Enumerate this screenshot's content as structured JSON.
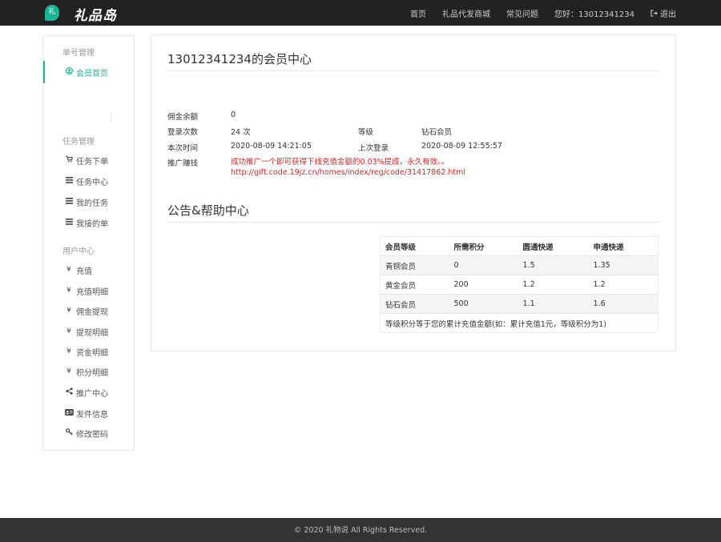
{
  "header": {
    "logo_badge": "礼",
    "logo_text": "礼品岛",
    "nav": [
      "首页",
      "礼品代发商城",
      "常见问题"
    ],
    "greeting": "您好：13012341234",
    "logout": "退出"
  },
  "sidebar": {
    "section1": "单号管理",
    "member_home": "会员首页",
    "section2": "任务管理",
    "task_items": [
      "任务下单",
      "任务中心",
      "我的任务",
      "我接的单"
    ],
    "section3": "用户中心",
    "user_items": [
      "充值",
      "充值明细",
      "佣金提现",
      "提现明细",
      "资金明细",
      "积分明细",
      "推广中心",
      "发件信息",
      "修改密码"
    ]
  },
  "main": {
    "title": "13012341234的会员中心",
    "labels": {
      "commission": "佣金余额",
      "login_count": "登录次数",
      "level": "等级",
      "this_time": "本次时间",
      "last_login": "上次登录",
      "promote": "推广赚钱"
    },
    "values": {
      "commission": "0",
      "login_count": "24 次",
      "level": "钻石会员",
      "this_time": "2020-08-09 14:21:05",
      "last_login": "2020-08-09 12:55:57"
    },
    "promo_line1": "成功推广一个即可获得下线充值金额的0.03%提成，永久有效。。",
    "promo_line2": "http://gift.code.19jz.cn/homes/index/reg/code/31417862.html",
    "section_title": "公告&帮助中心",
    "table": {
      "headers": [
        "会员等级",
        "所需积分",
        "圆通快递",
        "申通快递"
      ],
      "rows": [
        [
          "青铜会员",
          "0",
          "1.5",
          "1.35"
        ],
        [
          "黄金会员",
          "200",
          "1.2",
          "1.2"
        ],
        [
          "钻石会员",
          "500",
          "1.1",
          "1.6"
        ]
      ],
      "note": "等级积分等于您的累计充值金额(如：累计充值1元，等级积分为1)"
    }
  },
  "footer": {
    "copyright": "© 2020 礼物说 All Rights Reserved."
  },
  "colors": {
    "accent": "#1ab394",
    "header_bg": "#222222",
    "footer_bg": "#333333",
    "promo": "#e02020"
  }
}
